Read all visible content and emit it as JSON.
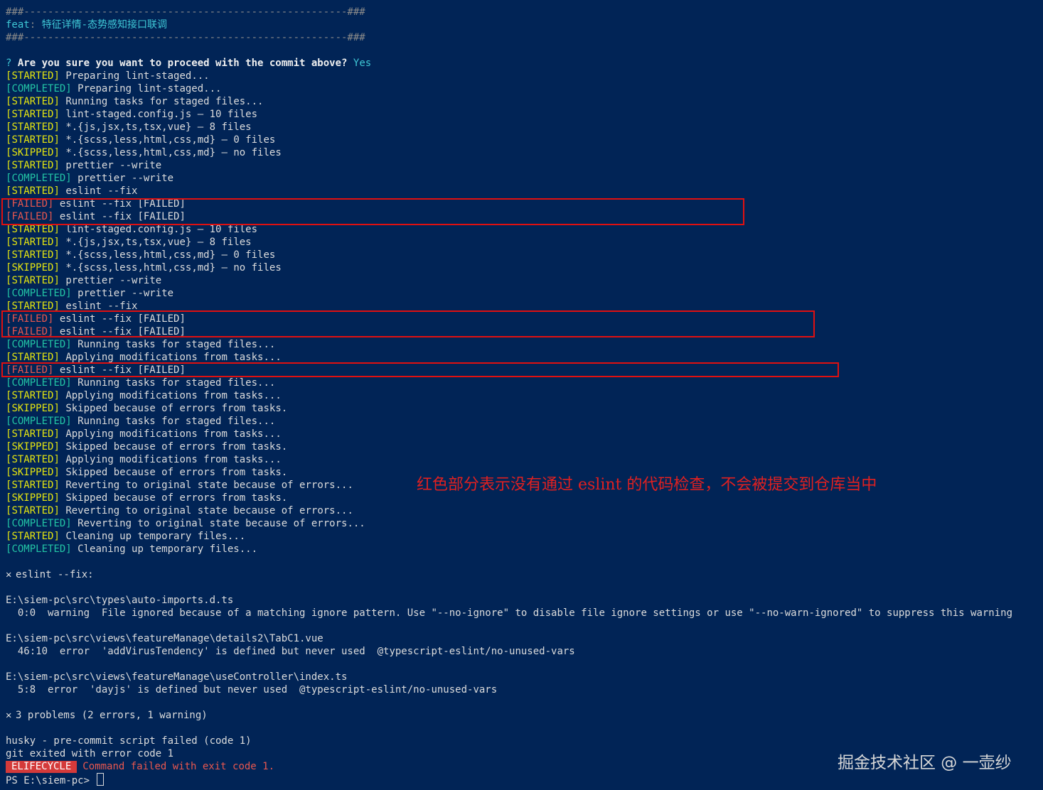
{
  "header": {
    "rule_top": "###------------------------------------------------------###",
    "commit_type": "feat",
    "commit_subject": "特征详情-态势感知接口联调",
    "rule_bottom": "###------------------------------------------------------###"
  },
  "prompt": {
    "mark": "?",
    "question": "Are you sure you want to proceed with the commit above?",
    "answer": "Yes"
  },
  "log_lines": [
    {
      "tag": "STARTED",
      "text": "Preparing lint-staged..."
    },
    {
      "tag": "COMPLETED",
      "text": "Preparing lint-staged..."
    },
    {
      "tag": "STARTED",
      "text": "Running tasks for staged files..."
    },
    {
      "tag": "STARTED",
      "text": "lint-staged.config.js — 10 files"
    },
    {
      "tag": "STARTED",
      "text": "*.{js,jsx,ts,tsx,vue} — 8 files"
    },
    {
      "tag": "STARTED",
      "text": "*.{scss,less,html,css,md} — 0 files"
    },
    {
      "tag": "SKIPPED",
      "text": "*.{scss,less,html,css,md} — no files"
    },
    {
      "tag": "STARTED",
      "text": "prettier --write"
    },
    {
      "tag": "COMPLETED",
      "text": "prettier --write"
    },
    {
      "tag": "STARTED",
      "text": "eslint --fix"
    },
    {
      "tag": "FAILED",
      "text": "eslint --fix [FAILED]"
    },
    {
      "tag": "FAILED",
      "text": "eslint --fix [FAILED]"
    },
    {
      "tag": "STARTED",
      "text": "lint-staged.config.js — 10 files"
    },
    {
      "tag": "STARTED",
      "text": "*.{js,jsx,ts,tsx,vue} — 8 files"
    },
    {
      "tag": "STARTED",
      "text": "*.{scss,less,html,css,md} — 0 files"
    },
    {
      "tag": "SKIPPED",
      "text": "*.{scss,less,html,css,md} — no files"
    },
    {
      "tag": "STARTED",
      "text": "prettier --write"
    },
    {
      "tag": "COMPLETED",
      "text": "prettier --write"
    },
    {
      "tag": "STARTED",
      "text": "eslint --fix"
    },
    {
      "tag": "FAILED",
      "text": "eslint --fix [FAILED]"
    },
    {
      "tag": "FAILED",
      "text": "eslint --fix [FAILED]"
    },
    {
      "tag": "COMPLETED",
      "text": "Running tasks for staged files..."
    },
    {
      "tag": "STARTED",
      "text": "Applying modifications from tasks..."
    },
    {
      "tag": "FAILED",
      "text": "eslint --fix [FAILED]"
    },
    {
      "tag": "COMPLETED",
      "text": "Running tasks for staged files..."
    },
    {
      "tag": "STARTED",
      "text": "Applying modifications from tasks..."
    },
    {
      "tag": "SKIPPED",
      "text": "Skipped because of errors from tasks."
    },
    {
      "tag": "COMPLETED",
      "text": "Running tasks for staged files..."
    },
    {
      "tag": "STARTED",
      "text": "Applying modifications from tasks..."
    },
    {
      "tag": "SKIPPED",
      "text": "Skipped because of errors from tasks."
    },
    {
      "tag": "STARTED",
      "text": "Applying modifications from tasks..."
    },
    {
      "tag": "SKIPPED",
      "text": "Skipped because of errors from tasks."
    },
    {
      "tag": "STARTED",
      "text": "Reverting to original state because of errors..."
    },
    {
      "tag": "SKIPPED",
      "text": "Skipped because of errors from tasks."
    },
    {
      "tag": "STARTED",
      "text": "Reverting to original state because of errors..."
    },
    {
      "tag": "COMPLETED",
      "text": "Reverting to original state because of errors..."
    },
    {
      "tag": "STARTED",
      "text": "Cleaning up temporary files..."
    },
    {
      "tag": "COMPLETED",
      "text": "Cleaning up temporary files..."
    }
  ],
  "eslint_report": {
    "heading": "eslint --fix:",
    "files": [
      {
        "path": "E:\\siem-pc\\src\\types\\auto-imports.d.ts",
        "message": "  0:0  warning  File ignored because of a matching ignore pattern. Use \"--no-ignore\" to disable file ignore settings or use \"--no-warn-ignored\" to suppress this warning"
      },
      {
        "path": "E:\\siem-pc\\src\\views\\featureManage\\details2\\TabC1.vue",
        "message": "  46:10  error  'addVirusTendency' is defined but never used  @typescript-eslint/no-unused-vars"
      },
      {
        "path": "E:\\siem-pc\\src\\views\\featureManage\\useController\\index.ts",
        "message": "  5:8  error  'dayjs' is defined but never used  @typescript-eslint/no-unused-vars"
      }
    ],
    "summary": "3 problems (2 errors, 1 warning)"
  },
  "footer": {
    "husky": "husky - pre-commit script failed (code 1)",
    "git": "git exited with error code 1",
    "badge": "ELIFECYCLE",
    "error_message": "Command failed with exit code 1.",
    "ps_prompt": "PS E:\\siem-pc> "
  },
  "annotation": "红色部分表示没有通过 eslint 的代码检查，不会被提交到仓库当中",
  "watermark": "掘金技术社区 @ 一壶纱",
  "colors": {
    "background": "#012456",
    "started": "#e5e510",
    "completed": "#23c5a5",
    "failed": "#e8574f",
    "highlight_box": "#e01010"
  }
}
